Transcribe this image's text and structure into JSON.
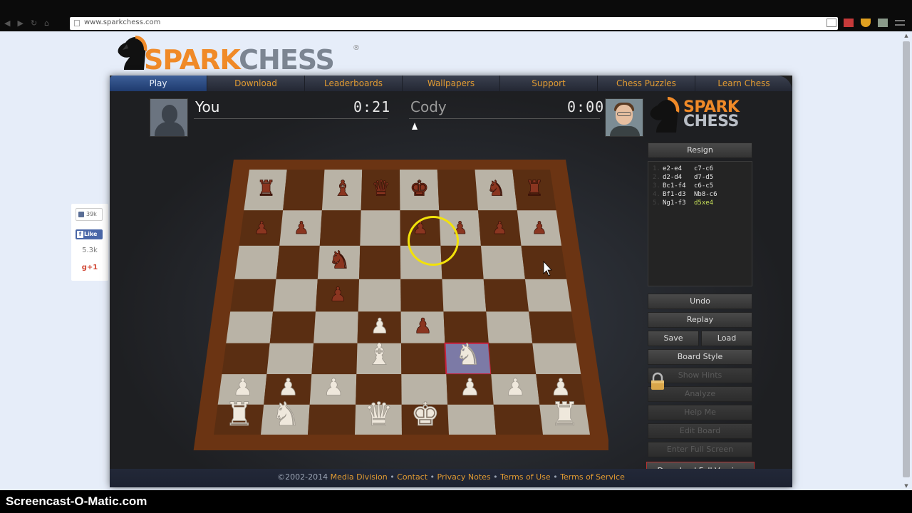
{
  "browser": {
    "url": "www.sparkchess.com",
    "nav_icons": [
      "back-icon",
      "forward-icon",
      "reload-icon",
      "home-icon"
    ],
    "extension_icons": [
      "bookmark-star-icon",
      "gmail-icon",
      "shield-extension-icon",
      "extension-icon",
      "menu-icon"
    ]
  },
  "site": {
    "logo_spark": "SPARK",
    "logo_chess": "CHESS",
    "logo_reg": "®",
    "nav": [
      {
        "label": "Play",
        "active": true
      },
      {
        "label": "Download",
        "active": false
      },
      {
        "label": "Leaderboards",
        "active": false
      },
      {
        "label": "Wallpapers",
        "active": false
      },
      {
        "label": "Support",
        "active": false
      },
      {
        "label": "Chess Puzzles",
        "active": false
      },
      {
        "label": "Learn Chess",
        "active": false
      }
    ],
    "accent_color": "#e09a32"
  },
  "game": {
    "player": {
      "name": "You",
      "clock": "0:21"
    },
    "opponent": {
      "name": "Cody",
      "clock": "0:00"
    },
    "side_logo_line1": "SPARK",
    "side_logo_line2": "CHESS",
    "resign_label": "Resign",
    "moves": [
      {
        "num": "1.",
        "white": "e2-e4",
        "black": "c7-c6"
      },
      {
        "num": "2.",
        "white": "d2-d4",
        "black": "d7-d5"
      },
      {
        "num": "3.",
        "white": "Bc1-f4",
        "black": "c6-c5"
      },
      {
        "num": "4.",
        "white": "Bf1-d3",
        "black": "Nb8-c6"
      },
      {
        "num": "5.",
        "white": "Ng1-f3",
        "black": "d5xe4"
      }
    ],
    "buttons": {
      "undo": "Undo",
      "replay": "Replay",
      "save": "Save",
      "load": "Load",
      "board_style": "Board Style",
      "show_hints": "Show Hints",
      "analyze": "Analyze",
      "help_me": "Help Me",
      "edit_board": "Edit Board",
      "full_screen": "Enter Full Screen",
      "download_full": "Download Full Version"
    },
    "board": {
      "ranks": [
        "r.bqk.nr",
        "pp..pppp",
        "..n.....",
        "..p.....",
        "...Pp...",
        "...B.N..",
        "PPP..PPP",
        "RN.QK..R"
      ],
      "highlight_square": "f3",
      "light_square": "#b9b3a6",
      "dark_square": "#5a2e12",
      "frame_color": "#6b3413"
    }
  },
  "footer": {
    "copyright": "©2002-2014",
    "links": [
      "Media Division",
      "Contact",
      "Privacy Notes",
      "Terms of Use",
      "Terms of Service"
    ]
  },
  "social": {
    "like_count": "39k",
    "fb_like": "Like",
    "gplus_count": "5.3k",
    "gplus_label": "g+1"
  },
  "watermark": "Screencast-O-Matic.com"
}
